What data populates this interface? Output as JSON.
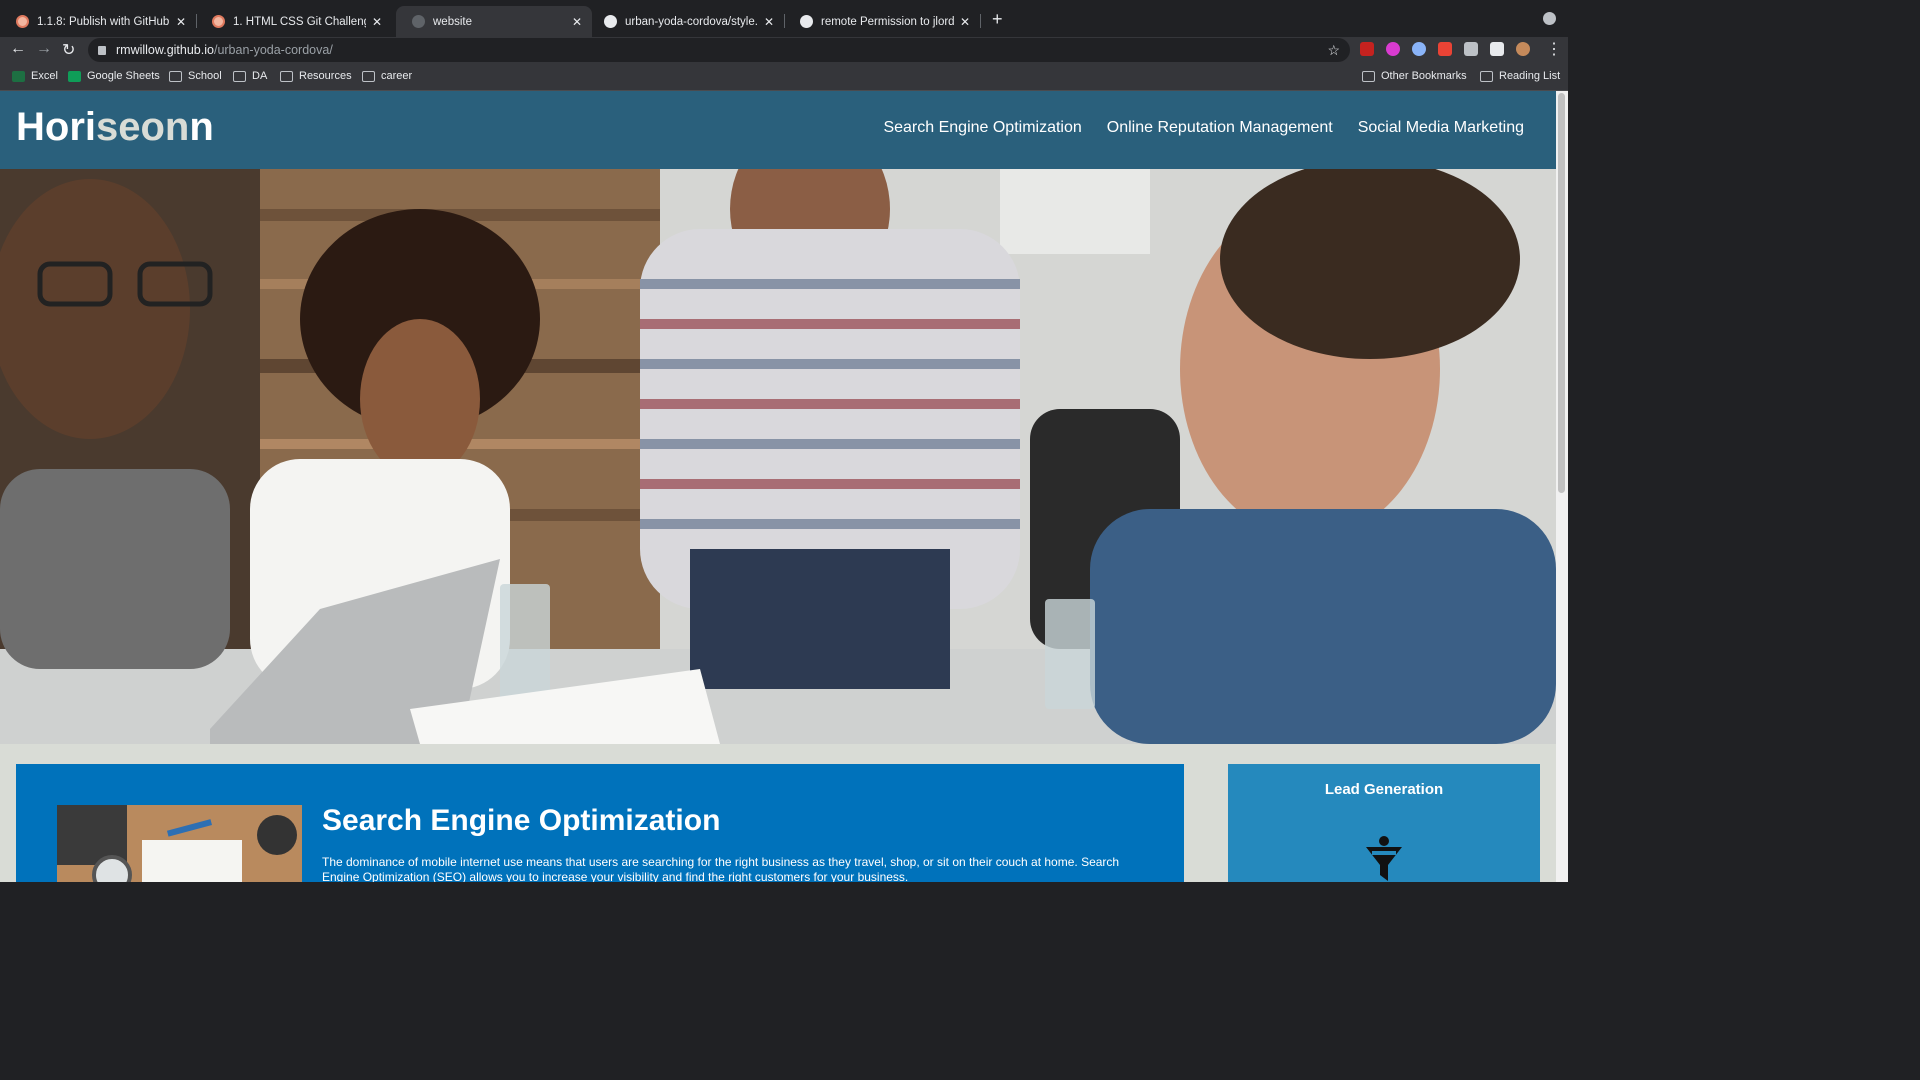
{
  "browser": {
    "tabs": [
      {
        "title": "1.1.8: Publish with GitHub Pages",
        "favicon": "course-icon",
        "active": false
      },
      {
        "title": "1. HTML CSS Git Challenge: Code",
        "favicon": "course-icon",
        "active": false
      },
      {
        "title": "website",
        "favicon": "globe-icon",
        "active": true
      },
      {
        "title": "urban-yoda-cordova/style.css",
        "favicon": "github-icon",
        "active": false
      },
      {
        "title": "remote Permission to jlord/patch",
        "favicon": "github-icon",
        "active": false
      }
    ],
    "address": {
      "host": "rmwillow.github.io",
      "path": "/urban-yoda-cordova/"
    },
    "bookmarks": [
      "Excel",
      "Google Sheets",
      "School",
      "DA",
      "Resources",
      "career"
    ],
    "bookmarks_right": [
      "Other Bookmarks",
      "Reading List"
    ]
  },
  "site": {
    "logo_main": "Hori",
    "logo_accent": "seon",
    "logo_tail": "n",
    "nav": [
      "Search Engine Optimization",
      "Online Reputation Management",
      "Social Media Marketing"
    ],
    "section_title": "Search Engine Optimization",
    "section_text": "The dominance of mobile internet use means that users are searching for the right business as they travel, shop, or sit on their couch at home. Search Engine Optimization (SEO) allows you to increase your visibility and find the right customers for your business.",
    "benefit_title": "Lead Generation"
  },
  "colors": {
    "header": "#2a607c",
    "content": "#0072bb",
    "benefits": "#2589bd",
    "page_bg": "#d9dcd6"
  }
}
